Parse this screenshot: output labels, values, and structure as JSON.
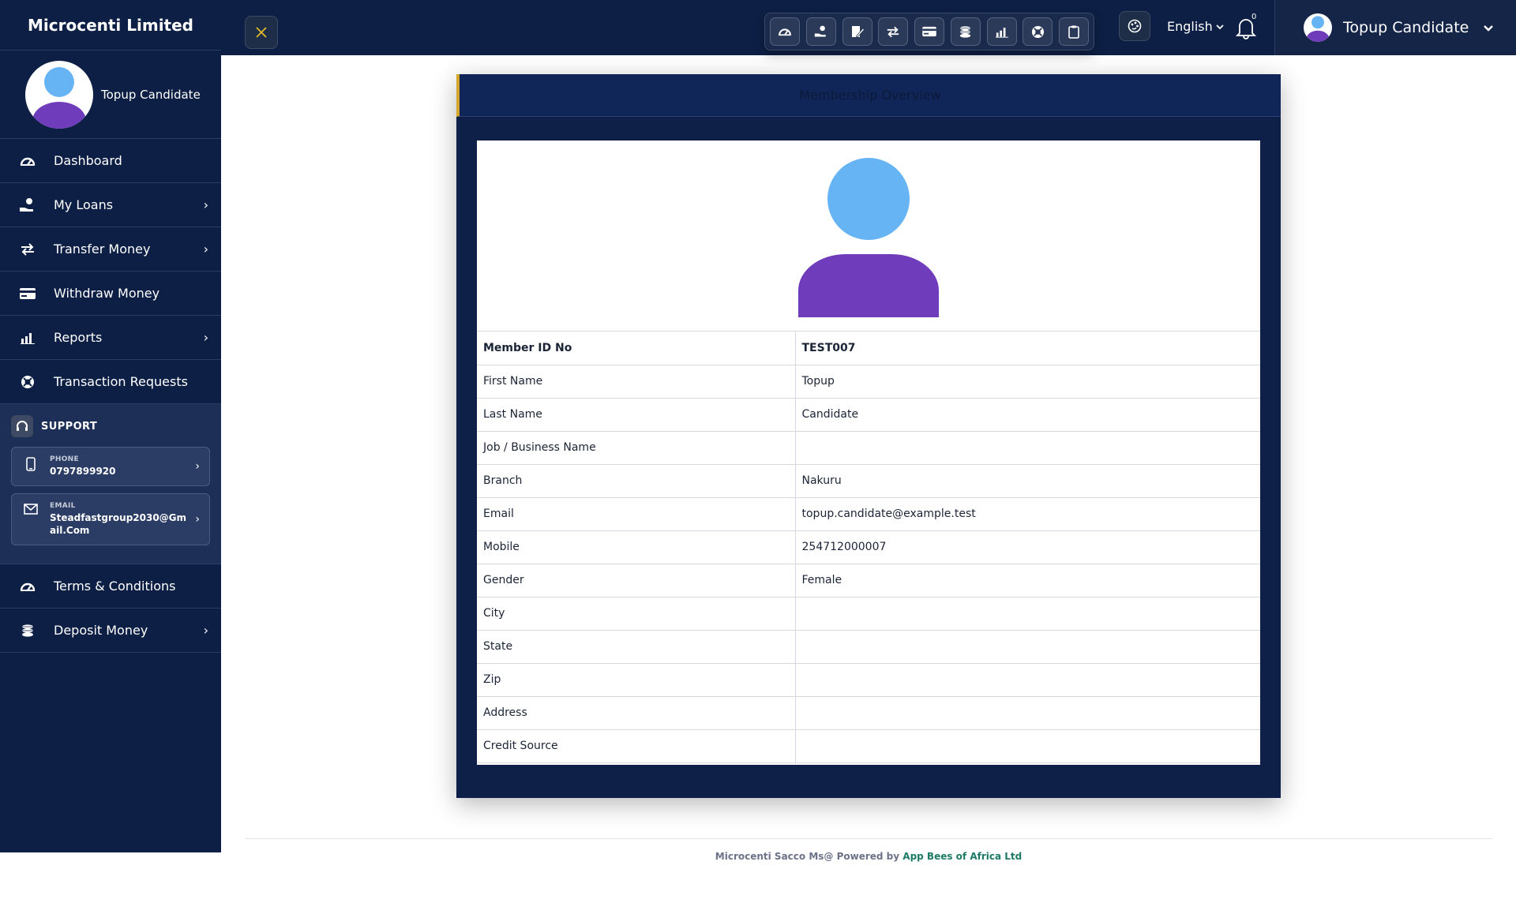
{
  "brand": "Microcenti Limited",
  "sidebar": {
    "profile_name": "Topup Candidate",
    "items": [
      {
        "label": "Dashboard",
        "icon": "dashboard-icon",
        "has_submenu": false
      },
      {
        "label": "My Loans",
        "icon": "hand-coin-icon",
        "has_submenu": true
      },
      {
        "label": "Transfer Money",
        "icon": "transfer-arrows-icon",
        "has_submenu": true
      },
      {
        "label": "Withdraw Money",
        "icon": "card-icon",
        "has_submenu": false
      },
      {
        "label": "Reports",
        "icon": "bar-chart-icon",
        "has_submenu": true
      },
      {
        "label": "Transaction Requests",
        "icon": "lifebuoy-icon",
        "has_submenu": false
      }
    ],
    "support": {
      "title": "SUPPORT",
      "phone_label": "PHONE",
      "phone_value": "0797899920",
      "email_label": "EMAIL",
      "email_value": "Steadfastgroup2030@Gmail.Com"
    },
    "bottom_items": [
      {
        "label": "Terms & Conditions",
        "icon": "dashboard-icon",
        "has_submenu": false
      },
      {
        "label": "Deposit Money",
        "icon": "coins-icon",
        "has_submenu": true
      }
    ]
  },
  "topbar": {
    "quick_icons": [
      "dashboard-icon",
      "hand-coin-icon",
      "edit-doc-icon",
      "transfer-arrows-icon",
      "card-icon",
      "coins-icon",
      "bar-chart-icon",
      "lifebuoy-icon",
      "clipboard-icon"
    ],
    "language": "English",
    "notification_count": "0",
    "user_name": "Topup Candidate"
  },
  "main": {
    "title": "Membership Overview",
    "rows": [
      {
        "label": "Member ID No",
        "value": "TEST007"
      },
      {
        "label": "First Name",
        "value": "Topup"
      },
      {
        "label": "Last Name",
        "value": "Candidate"
      },
      {
        "label": "Job / Business Name",
        "value": ""
      },
      {
        "label": "Branch",
        "value": "Nakuru"
      },
      {
        "label": "Email",
        "value": "topup.candidate@example.test"
      },
      {
        "label": "Mobile",
        "value": "254712000007"
      },
      {
        "label": "Gender",
        "value": "Female"
      },
      {
        "label": "City",
        "value": ""
      },
      {
        "label": "State",
        "value": ""
      },
      {
        "label": "Zip",
        "value": ""
      },
      {
        "label": "Address",
        "value": ""
      },
      {
        "label": "Credit Source",
        "value": ""
      }
    ]
  },
  "footer": {
    "text": "Microcenti Sacco Ms@ Powered by",
    "link": "App Bees of Africa Ltd"
  },
  "colors": {
    "navy": "#0d1f44",
    "accent": "#d4a72c",
    "avatar_head": "#67b4f5",
    "avatar_body": "#6f3dbb",
    "footer_link": "#1d7a66"
  }
}
